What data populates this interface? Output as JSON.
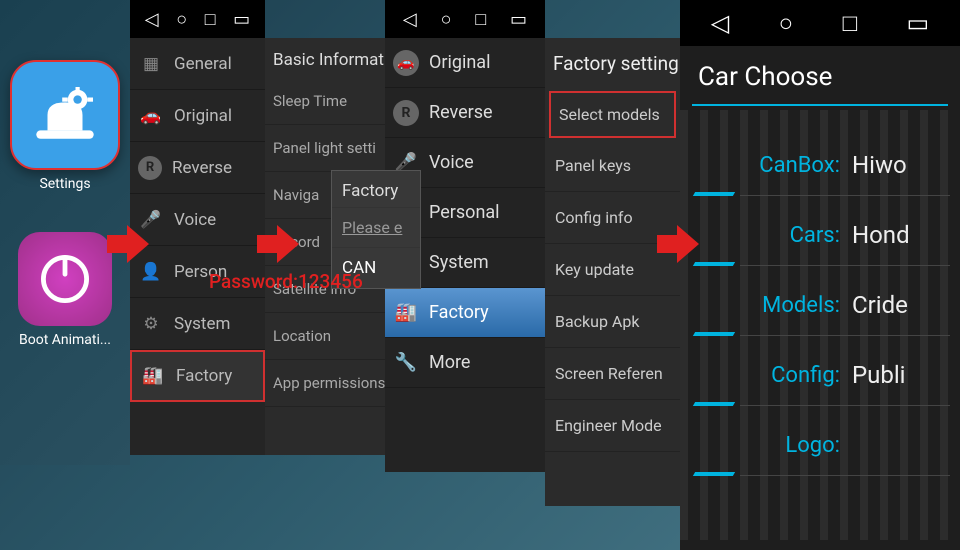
{
  "apps": {
    "settings_label": "Settings",
    "boot_label": "Boot Animati..."
  },
  "sidebar1": {
    "items": [
      "General",
      "Original",
      "Reverse",
      "Voice",
      "Person",
      "System",
      "Factory"
    ]
  },
  "basic": {
    "title": "Basic Informatio",
    "rows": [
      "Sleep Time",
      "Panel light setti",
      "Naviga",
      "Record",
      "Satellite info",
      "Location",
      "App permissions"
    ],
    "dialog": {
      "title": "Factory",
      "hint": "Please e",
      "cancel": "CAN"
    }
  },
  "sidebar2": {
    "items": [
      "Original",
      "Reverse",
      "Voice",
      "Personal",
      "System",
      "Factory",
      "More"
    ]
  },
  "factory": {
    "title": "Factory setting",
    "rows": [
      "Select models",
      "Panel keys",
      "Config info",
      "Key update",
      "Backup Apk",
      "Screen Referen",
      "Engineer Mode"
    ]
  },
  "carchoose": {
    "title": "Car Choose",
    "rows": [
      {
        "k": "CanBox:",
        "v": "Hiwo"
      },
      {
        "k": "Cars:",
        "v": "Hond"
      },
      {
        "k": "Models:",
        "v": "Cride"
      },
      {
        "k": "Config:",
        "v": "Publi"
      },
      {
        "k": "Logo:",
        "v": ""
      }
    ]
  },
  "password_label": "Password:123456"
}
